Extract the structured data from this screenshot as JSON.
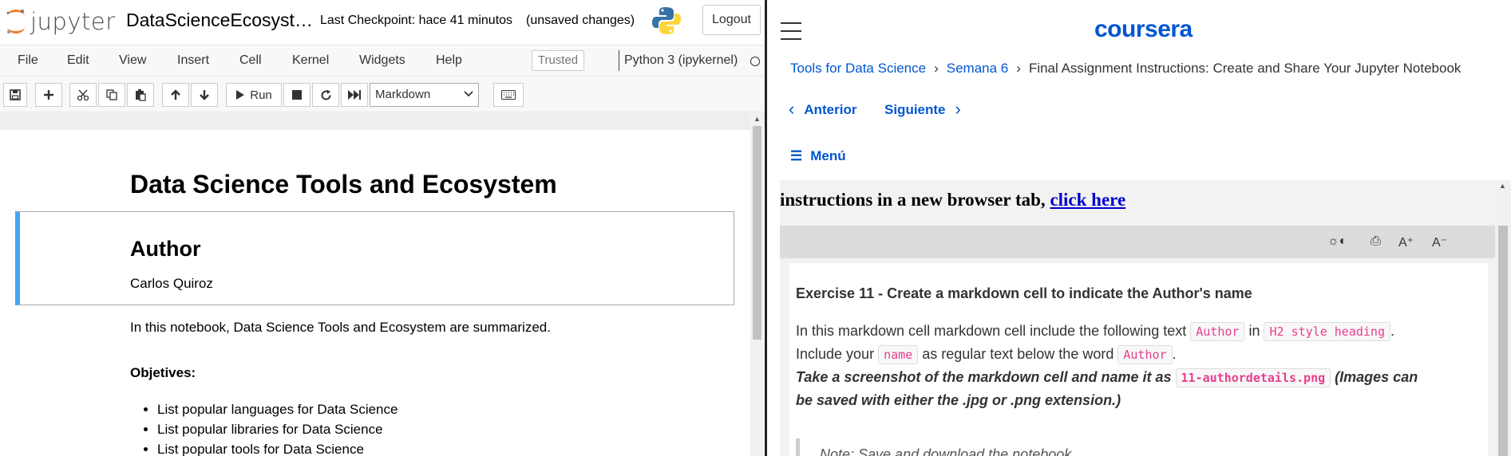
{
  "jupyter": {
    "logo_text": "jupyter",
    "notebook_title": "DataScienceEcosystem",
    "checkpoint": "Last Checkpoint: hace 41 minutos",
    "unsaved": "(unsaved changes)",
    "logout_label": "Logout",
    "menu": [
      "File",
      "Edit",
      "View",
      "Insert",
      "Cell",
      "Kernel",
      "Widgets",
      "Help"
    ],
    "trusted_label": "Trusted",
    "kernel": "Python 3 (ipykernel)",
    "toolbar": {
      "run_label": "Run",
      "cell_type": "Markdown",
      "icons": [
        "save-icon",
        "plus-icon",
        "cut-icon",
        "copy-icon",
        "paste-icon",
        "arrow-up-icon",
        "arrow-down-icon",
        "run-icon",
        "stop-icon",
        "restart-icon",
        "fast-forward-icon",
        "keyboard-icon"
      ]
    },
    "notebook": {
      "title": "Data Science Tools and Ecosystem",
      "author_heading": "Author",
      "author_name": "Carlos Quiroz",
      "summary": "In this notebook, Data Science Tools and Ecosystem are summarized.",
      "objectives_heading": "Objetives:",
      "objectives": [
        "List popular languages for Data Science",
        "List popular libraries for Data Science",
        "List popular tools for Data Science"
      ]
    }
  },
  "coursera": {
    "logo": "coursera",
    "breadcrumb": {
      "course": "Tools for Data Science",
      "week": "Semana 6",
      "current": "Final Assignment Instructions: Create and Share Your Jupyter Notebook"
    },
    "prev_label": "Anterior",
    "next_label": "Siguiente",
    "menu_label": "Menú",
    "clipped_text": "instructions in a new browser tab,",
    "clipped_link": "click here",
    "exercise": {
      "title": "Exercise 11 - Create a markdown cell to indicate the Author's name",
      "l1_a": "In this markdown cell markdown cell include the following text",
      "l1_code1": "Author",
      "l1_b": "in",
      "l1_code2": "H2 style heading",
      "l1_c": ".",
      "l2_a": "Include your",
      "l2_code1": "name",
      "l2_b": "as regular text below the word",
      "l2_code2": "Author",
      "l2_c": ".",
      "l3_a": "Take a screenshot of the markdown cell and name it as",
      "l3_code": "11-authordetails.png",
      "l3_b": "(Images can",
      "l4": "be saved with either the .jpg or .png extension.)",
      "note": "Note: Save and download the notebook."
    }
  },
  "colors": {
    "coursera_blue": "#0056d2",
    "selected_cell_border": "#42a5f5",
    "code_pink": "#e83e8c"
  }
}
